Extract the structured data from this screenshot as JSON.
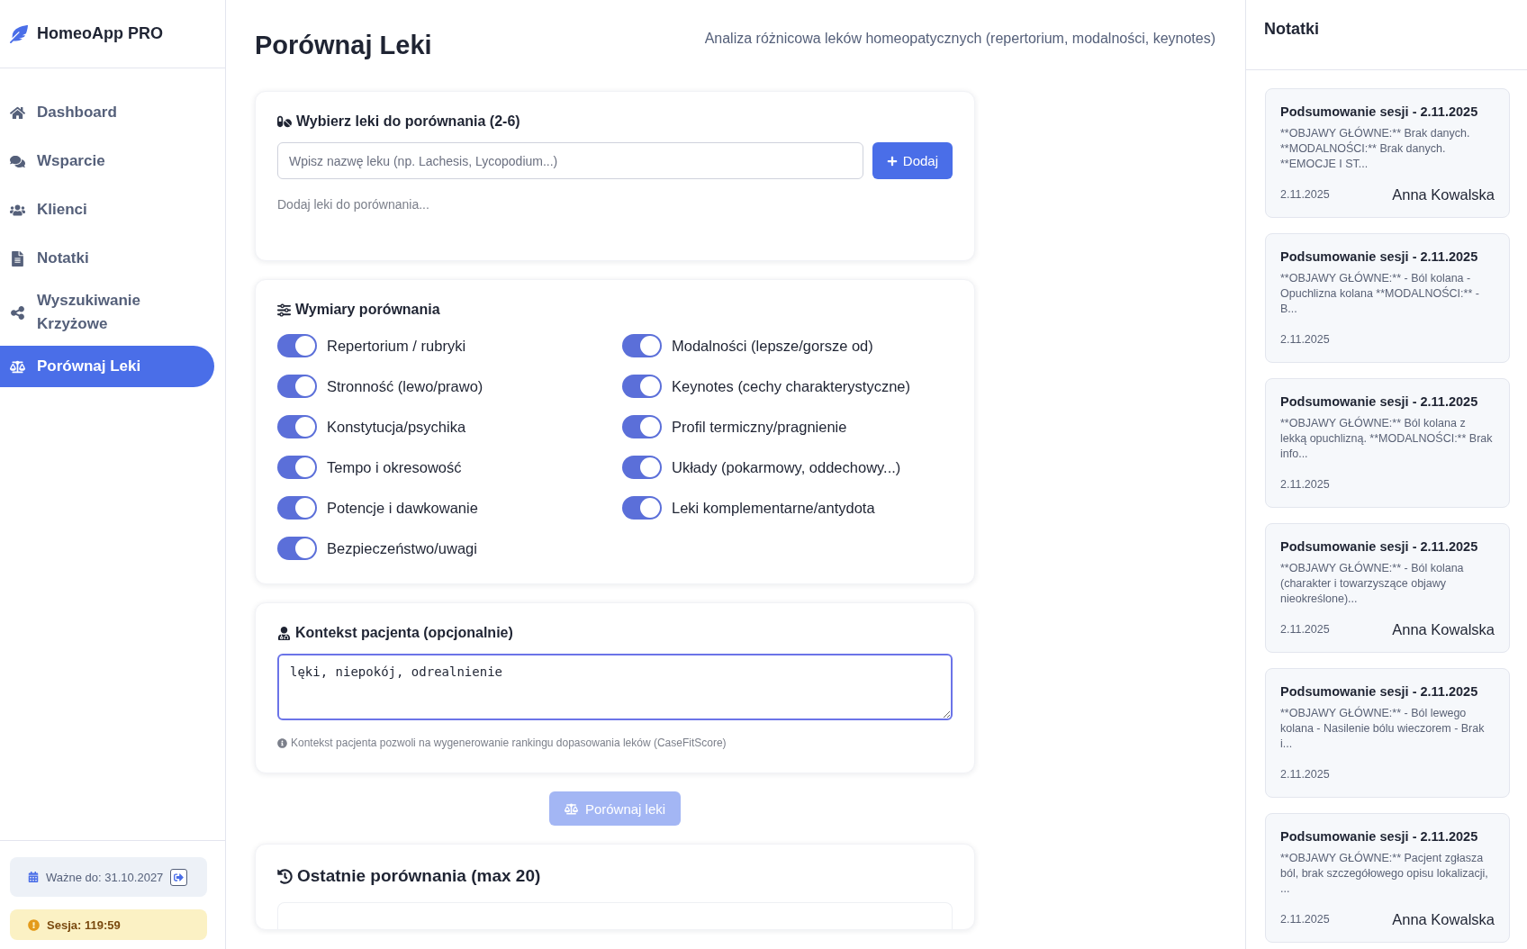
{
  "app": {
    "name": "HomeoApp PRO"
  },
  "sidebar": {
    "items": [
      {
        "label": "Dashboard",
        "selected": false
      },
      {
        "label": "Wsparcie",
        "selected": false
      },
      {
        "label": "Klienci",
        "selected": false
      },
      {
        "label": "Notatki",
        "selected": false
      },
      {
        "label": "Wyszukiwanie Krzyżowe",
        "selected": false
      },
      {
        "label": "Porównaj Leki",
        "selected": true
      }
    ],
    "validity": "Ważne do: 31.10.2027",
    "session": "Sesja: 119:59"
  },
  "page": {
    "title": "Porównaj Leki",
    "subtitle": "Analiza różnicowa leków homeopatycznych (repertorium, modalności, keynotes)"
  },
  "select_card": {
    "title": "Wybierz leki do porównania (2-6)",
    "placeholder": "Wpisz nazwę leku (np. Lachesis, Lycopodium...)",
    "add_button": "Dodaj",
    "empty_hint": "Dodaj leki do porównania..."
  },
  "dimensions_card": {
    "title": "Wymiary porównania",
    "toggles": [
      {
        "label": "Repertorium / rubryki",
        "on": true
      },
      {
        "label": "Modalności (lepsze/gorsze od)",
        "on": true
      },
      {
        "label": "Stronność (lewo/prawo)",
        "on": true
      },
      {
        "label": "Keynotes (cechy charakterystyczne)",
        "on": true
      },
      {
        "label": "Konstytucja/psychika",
        "on": true
      },
      {
        "label": "Profil termiczny/pragnienie",
        "on": true
      },
      {
        "label": "Tempo i okresowość",
        "on": true
      },
      {
        "label": "Układy (pokarmowy, oddechowy...)",
        "on": true
      },
      {
        "label": "Potencje i dawkowanie",
        "on": true
      },
      {
        "label": "Leki komplementarne/antydota",
        "on": true
      },
      {
        "label": "Bezpieczeństwo/uwagi",
        "on": true
      }
    ]
  },
  "context_card": {
    "title": "Kontekst pacjenta (opcjonalnie)",
    "value": "lęki, niepokój, odrealnienie",
    "hint": "Kontekst pacjenta pozwoli na wygenerowanie rankingu dopasowania leków (CaseFitScore)"
  },
  "compare_button": {
    "label": "Porównaj leki",
    "disabled": true
  },
  "history_card": {
    "title": "Ostatnie porównania (max 20)"
  },
  "notes_panel": {
    "title": "Notatki",
    "notes": [
      {
        "title": "Podsumowanie sesji - 2.11.2025",
        "body": "**OBJAWY GŁÓWNE:** Brak danych. **MODALNOŚCI:** Brak danych. **EMOCJE I ST...",
        "date": "2.11.2025",
        "author": "Anna Kowalska"
      },
      {
        "title": "Podsumowanie sesji - 2.11.2025",
        "body": "**OBJAWY GŁÓWNE:** - Ból kolana - Opuchlizna kolana **MODALNOŚCI:** - B...",
        "date": "2.11.2025"
      },
      {
        "title": "Podsumowanie sesji - 2.11.2025",
        "body": "**OBJAWY GŁÓWNE:** Ból kolana z lekką opuchlizną. **MODALNOŚCI:** Brak info...",
        "date": "2.11.2025"
      },
      {
        "title": "Podsumowanie sesji - 2.11.2025",
        "body": "**OBJAWY GŁÓWNE:** - Ból kolana (charakter i towarzyszące objawy nieokreślone)...",
        "date": "2.11.2025",
        "author": "Anna Kowalska"
      },
      {
        "title": "Podsumowanie sesji - 2.11.2025",
        "body": "**OBJAWY GŁÓWNE:** - Ból lewego kolana - Nasilenie bólu wieczorem - Brak i...",
        "date": "2.11.2025"
      },
      {
        "title": "Podsumowanie sesji - 2.11.2025",
        "body": "**OBJAWY GŁÓWNE:** Pacjent zgłasza ból, brak szczegółowego opisu lokalizacji, ...",
        "date": "2.11.2025",
        "author": "Anna Kowalska"
      }
    ]
  }
}
